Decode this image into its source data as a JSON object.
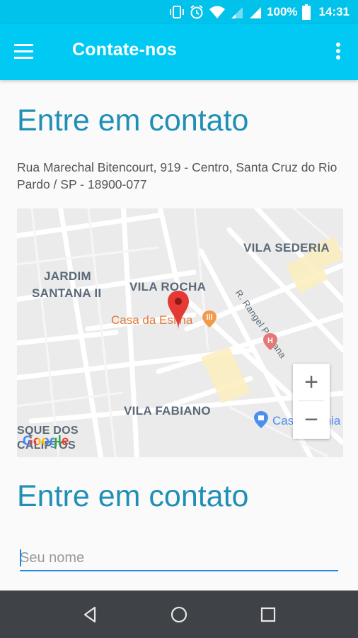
{
  "status_bar": {
    "battery": "100%",
    "time": "14:31"
  },
  "app_bar": {
    "title": "Contate-nos"
  },
  "section1": {
    "heading": "Entre em contato",
    "address": "Rua Marechal Bitencourt, 919 - Centro, Santa Cruz do Rio Pardo / SP - 18900-077"
  },
  "map": {
    "labels": {
      "vila_sederia": "VILA SEDERIA",
      "jardim_santana_1": "JARDIM",
      "jardim_santana_2": "SANTANA II",
      "vila_rocha": "VILA ROCHA",
      "vila_fabiano": "VILA FABIANO",
      "bosque_1": "SQUE DOS",
      "bosque_2": "CALIPTOS",
      "street": "R. Rangel Pestana"
    },
    "pois": {
      "casa_da_esfiha": "Casa da Esfiha",
      "casas_bahia": "Casas Bahia"
    },
    "zoom_in": "+",
    "zoom_out": "−",
    "attribution": "Google"
  },
  "section2": {
    "heading": "Entre em contato",
    "name_placeholder": "Seu nome"
  }
}
